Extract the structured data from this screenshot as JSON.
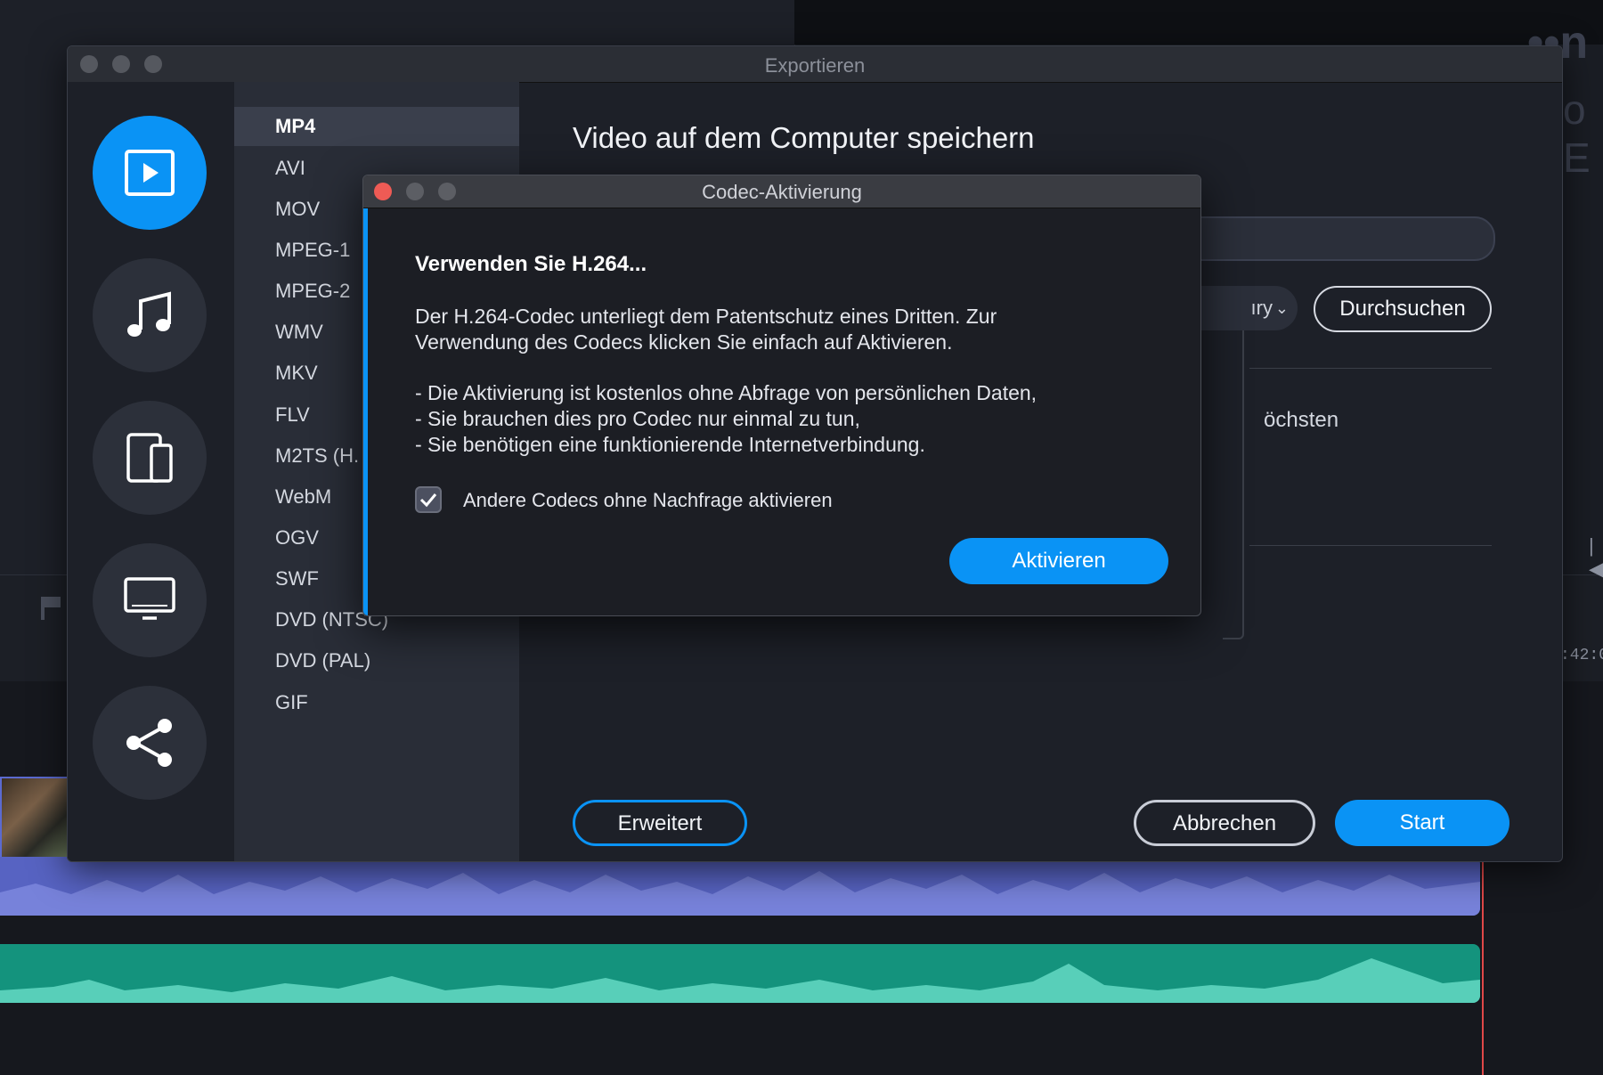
{
  "background": {
    "timecode": ":42:0",
    "skip_icon": "skip-back-icon",
    "flag_icon": "marker-flag-icon"
  },
  "export_window": {
    "title": "Exportieren",
    "nav": [
      {
        "name": "video",
        "icon": "video-play-icon",
        "active": true
      },
      {
        "name": "audio",
        "icon": "music-note-icon",
        "active": false
      },
      {
        "name": "devices",
        "icon": "devices-icon",
        "active": false
      },
      {
        "name": "tv",
        "icon": "monitor-icon",
        "active": false
      },
      {
        "name": "share",
        "icon": "share-icon",
        "active": false
      }
    ],
    "formats": [
      "MP4",
      "AVI",
      "MOV",
      "MPEG-1",
      "MPEG-2",
      "WMV",
      "MKV",
      "FLV",
      "M2TS (H.",
      "WebM",
      "OGV",
      "SWF",
      "DVD (NTSC)",
      "DVD (PAL)",
      "GIF"
    ],
    "selected_format": "MP4",
    "main_title": "Video auf dem Computer speichern",
    "folder_dropdown": "ıry",
    "browse_label": "Durchsuchen",
    "quality_label": "öchsten",
    "advanced_label": "Erweitert",
    "cancel_label": "Abbrechen",
    "start_label": "Start"
  },
  "codec_dialog": {
    "title": "Codec-Aktivierung",
    "heading": "Verwenden Sie H.264...",
    "paragraph": [
      "Der H.264-Codec unterliegt dem Patentschutz eines Dritten. Zur",
      "Verwendung des Codecs klicken Sie einfach auf Aktivieren."
    ],
    "bullets": [
      "- Die Aktivierung ist kostenlos ohne Abfrage von persönlichen Daten,",
      "- Sie brauchen dies pro Codec nur einmal zu tun,",
      "- Sie benötigen eine funktionierende Internetverbindung."
    ],
    "checkbox_label": "Andere Codecs ohne Nachfrage aktivieren",
    "checkbox_checked": true,
    "activate_label": "Aktivieren"
  },
  "colors": {
    "accent": "#0a93f5",
    "audio_track_1": "#5763c2",
    "audio_track_2": "#14937d",
    "close_dot": "#ee5b55",
    "playhead": "#e04848"
  }
}
